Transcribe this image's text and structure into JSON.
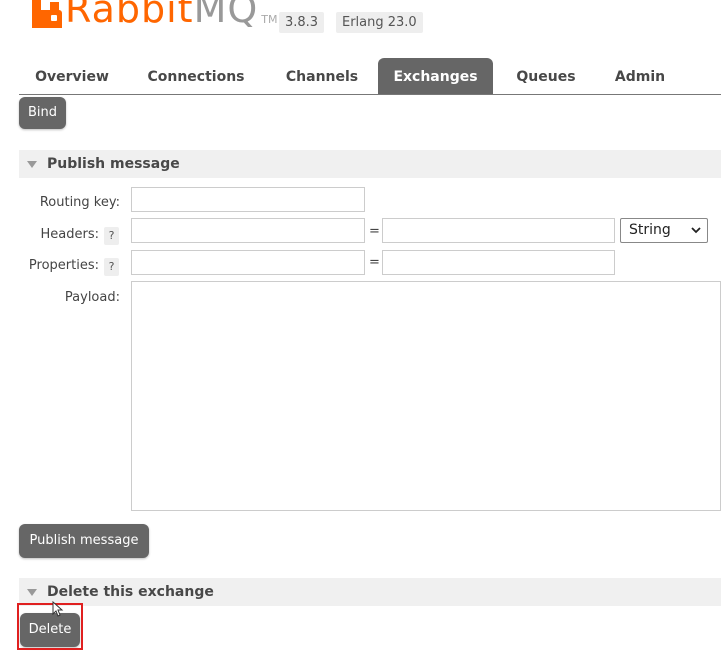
{
  "header": {
    "logo_text_primary": "Rabbit",
    "logo_text_secondary": "MQ",
    "logo_tm": "TM",
    "version": "3.8.3",
    "erlang": "Erlang 23.0",
    "brand_color": "#ff6600"
  },
  "tabs": [
    {
      "label": "Overview"
    },
    {
      "label": "Connections"
    },
    {
      "label": "Channels"
    },
    {
      "label": "Exchanges",
      "active": true
    },
    {
      "label": "Queues"
    },
    {
      "label": "Admin"
    }
  ],
  "bind_button": "Bind",
  "publish": {
    "section_title": "Publish message",
    "routing_key_label": "Routing key:",
    "routing_key_value": "",
    "headers_label": "Headers:",
    "headers_help": "?",
    "headers_key": "",
    "headers_value": "",
    "headers_type": "String",
    "equals": "=",
    "properties_label": "Properties:",
    "properties_help": "?",
    "properties_key": "",
    "properties_value": "",
    "payload_label": "Payload:",
    "payload_value": "",
    "button": "Publish message"
  },
  "delete": {
    "section_title": "Delete this exchange",
    "button": "Delete"
  },
  "icons": {
    "section_toggle": "triangle-down-icon",
    "select_chevron": "chevron-down-icon",
    "pointer": "mouse-cursor-icon"
  },
  "colors": {
    "button_bg": "#666666",
    "section_bg": "#f0f0f0",
    "highlight": "#e02020"
  }
}
